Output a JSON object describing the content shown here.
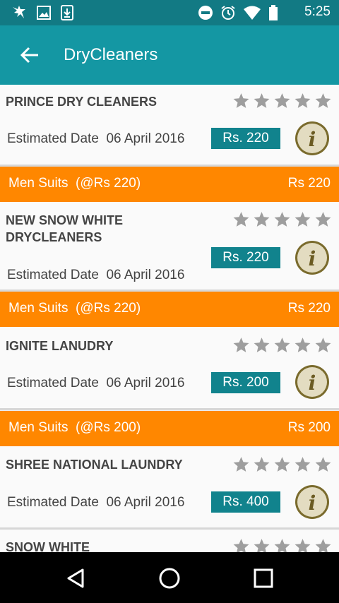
{
  "status_bar": {
    "time": "5:25",
    "icons": [
      "settings-icon",
      "image-icon",
      "download-icon",
      "dnd-icon",
      "alarm-icon",
      "wifi-icon",
      "battery-icon"
    ]
  },
  "app_bar": {
    "title": "DryCleaners"
  },
  "stars_total": 5,
  "items": [
    {
      "name": "PRINCE DRY CLEANERS",
      "estimated_label": "Estimated Date",
      "date": "06 April 2016",
      "price": "Rs. 220",
      "rating": 0,
      "order": {
        "label": "Men Suits",
        "rate": "(@Rs 220)",
        "amount": "Rs 220"
      }
    },
    {
      "name": "NEW SNOW WHITE DRYCLEANERS",
      "estimated_label": "Estimated Date",
      "date": "06 April 2016",
      "price": "Rs. 220",
      "rating": 0,
      "order": {
        "label": "Men Suits",
        "rate": "(@Rs 220)",
        "amount": "Rs 220"
      }
    },
    {
      "name": "IGNITE LANUDRY",
      "estimated_label": "Estimated Date",
      "date": "06 April 2016",
      "price": "Rs. 200",
      "rating": 0,
      "order": {
        "label": "Men Suits",
        "rate": "(@Rs 200)",
        "amount": "Rs 200"
      }
    },
    {
      "name": "SHREE NATIONAL LAUNDRY",
      "estimated_label": "Estimated Date",
      "date": "06 April 2016",
      "price": "Rs. 400",
      "rating": 0
    },
    {
      "name": "SNOW WHITE",
      "rating": 0
    }
  ],
  "colors": {
    "header": "#1497a3",
    "status": "#127a84",
    "accent": "#ff8700",
    "price": "#11838d"
  }
}
